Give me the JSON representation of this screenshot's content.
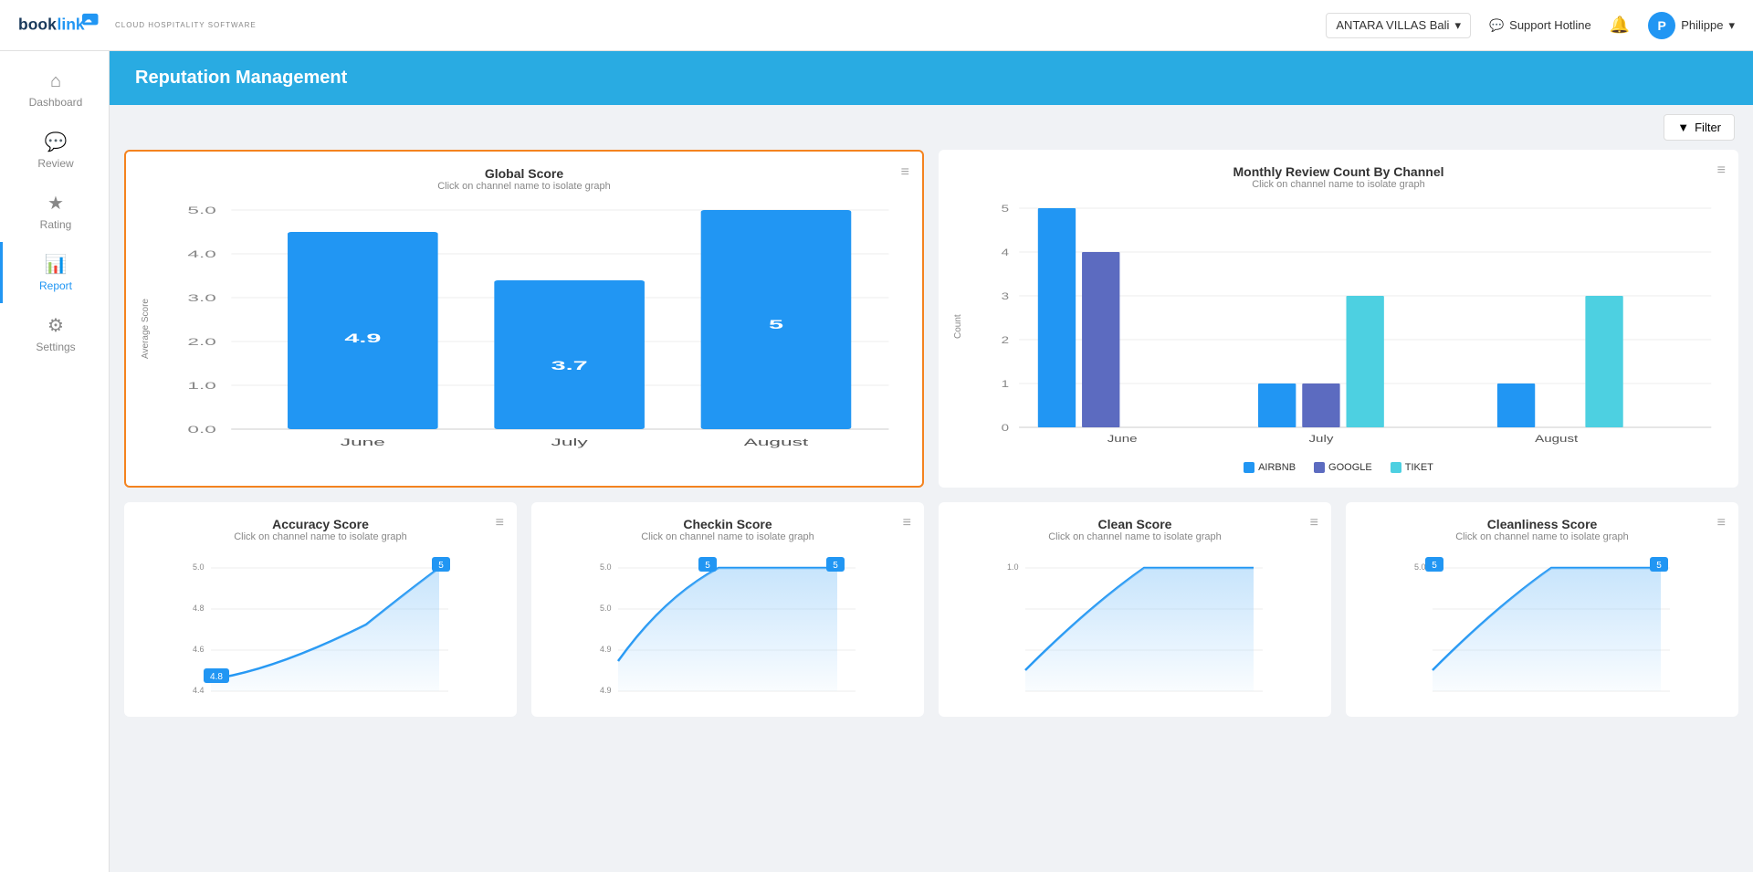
{
  "app": {
    "logo_main": "book",
    "logo_accent": "link",
    "logo_sub": "CLOUD HOSPITALITY SOFTWARE",
    "hotel_name": "ANTARA VILLAS Bali",
    "support_label": "Support Hotline",
    "user_name": "Philippe",
    "notification_icon": "🔔"
  },
  "sidebar": {
    "items": [
      {
        "id": "dashboard",
        "label": "Dashboard",
        "icon": "⌂",
        "active": false
      },
      {
        "id": "review",
        "label": "Review",
        "icon": "💬",
        "active": false
      },
      {
        "id": "rating",
        "label": "Rating",
        "icon": "★",
        "active": false
      },
      {
        "id": "report",
        "label": "Report",
        "icon": "📊",
        "active": true
      },
      {
        "id": "settings",
        "label": "Settings",
        "icon": "⚙",
        "active": false
      }
    ]
  },
  "page": {
    "title": "Reputation Management"
  },
  "toolbar": {
    "filter_label": "Filter"
  },
  "charts": {
    "global_score": {
      "title": "Global Score",
      "subtitle": "Click on channel name to isolate graph",
      "y_label": "Average Score",
      "highlighted": true,
      "bars": [
        {
          "month": "June",
          "value": 4.9,
          "label": "4.9",
          "color": "#2196f3",
          "height_pct": 90
        },
        {
          "month": "July",
          "value": 3.7,
          "label": "3.7",
          "color": "#2196f3",
          "height_pct": 68
        },
        {
          "month": "August",
          "value": 5.0,
          "label": "5",
          "color": "#2196f3",
          "height_pct": 93
        }
      ],
      "y_ticks": [
        "5.0",
        "4.0",
        "3.0",
        "2.0",
        "1.0",
        "0.0"
      ]
    },
    "monthly_review": {
      "title": "Monthly Review Count By Channel",
      "subtitle": "Click on channel name to isolate graph",
      "y_label": "Count",
      "highlighted": false,
      "legend": [
        {
          "label": "AIRBNB",
          "color": "#2196f3"
        },
        {
          "label": "GOOGLE",
          "color": "#5c6bc0"
        },
        {
          "label": "TIKET",
          "color": "#4dd0e1"
        }
      ],
      "months": [
        "June",
        "July",
        "August"
      ],
      "y_ticks": [
        "5",
        "4",
        "3",
        "2",
        "1",
        "0"
      ],
      "groups": [
        {
          "month": "June",
          "bars": [
            {
              "channel": "AIRBNB",
              "value": 5,
              "color": "#2196f3",
              "height_pct": 90
            },
            {
              "channel": "GOOGLE",
              "value": 4,
              "color": "#5c6bc0",
              "height_pct": 72
            },
            {
              "channel": "TIKET",
              "value": 0,
              "color": "#4dd0e1",
              "height_pct": 0
            }
          ]
        },
        {
          "month": "July",
          "bars": [
            {
              "channel": "AIRBNB",
              "value": 1,
              "color": "#2196f3",
              "height_pct": 18
            },
            {
              "channel": "GOOGLE",
              "value": 1,
              "color": "#5c6bc0",
              "height_pct": 18
            },
            {
              "channel": "TIKET",
              "value": 3,
              "color": "#4dd0e1",
              "height_pct": 54
            }
          ]
        },
        {
          "month": "August",
          "bars": [
            {
              "channel": "AIRBNB",
              "value": 1,
              "color": "#2196f3",
              "height_pct": 18
            },
            {
              "channel": "GOOGLE",
              "value": 0,
              "color": "#5c6bc0",
              "height_pct": 0
            },
            {
              "channel": "TIKET",
              "value": 3,
              "color": "#4dd0e1",
              "height_pct": 54
            }
          ]
        }
      ]
    },
    "accuracy_score": {
      "title": "Accuracy Score",
      "subtitle": "Click on channel name to isolate graph",
      "start_val": "4.8",
      "end_val": "5",
      "y_range_top": "5.0",
      "y_ticks": [
        "5.0",
        "4.8",
        "4.6",
        "4.4"
      ]
    },
    "checkin_score": {
      "title": "Checkin Score",
      "subtitle": "Click on channel name to isolate graph",
      "start_val": "5",
      "end_val": "5",
      "y_range_top": "5.0",
      "y_ticks": [
        "5.0",
        "5.0",
        "4.9",
        "4.9"
      ]
    },
    "clean_score": {
      "title": "Clean Score",
      "subtitle": "Click on channel name to isolate graph",
      "start_val": "",
      "end_val": "",
      "y_range_top": "1.0",
      "y_ticks": [
        "1.0",
        "",
        "",
        ""
      ]
    },
    "cleanliness_score": {
      "title": "Cleanliness Score",
      "subtitle": "Click on channel name to isolate graph",
      "start_val": "5",
      "end_val": "5",
      "y_range_top": "5.0",
      "y_ticks": [
        "5.0",
        "",
        "",
        ""
      ]
    }
  }
}
